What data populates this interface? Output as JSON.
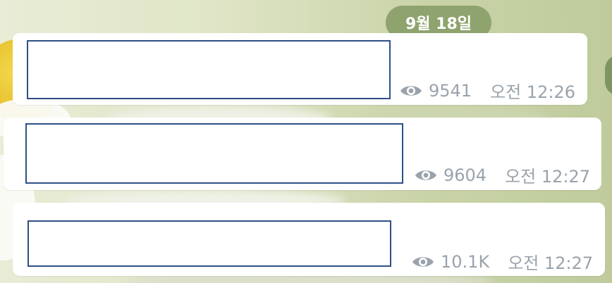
{
  "chat": {
    "date_label": "9월 18일",
    "messages": [
      {
        "views": "9541",
        "time": "오전 12:26"
      },
      {
        "views": "9604",
        "time": "오전 12:27"
      },
      {
        "views": "10.1K",
        "time": "오전 12:27"
      }
    ]
  },
  "icons": {
    "views": "eye-icon"
  },
  "colors": {
    "date_pill": "#8fa36e",
    "meta_text": "#9aa3ab",
    "redaction_border": "#2f4f86",
    "link": "#2f75c6"
  }
}
